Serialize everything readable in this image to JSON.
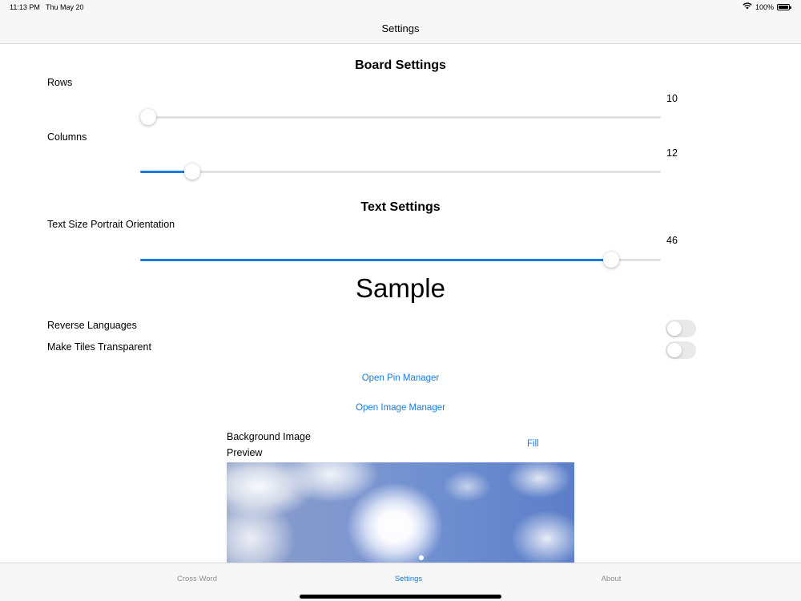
{
  "status_bar": {
    "time": "11:13 PM",
    "date": "Thu May 20",
    "battery": "100%",
    "icons": [
      "wifi-icon",
      "battery-icon"
    ]
  },
  "nav": {
    "title": "Settings"
  },
  "board_settings": {
    "title": "Board Settings",
    "rows": {
      "label": "Rows",
      "value": "10",
      "fill_fraction": 0.01
    },
    "columns": {
      "label": "Columns",
      "value": "12",
      "fill_fraction": 0.1
    }
  },
  "text_settings": {
    "title": "Text Settings",
    "text_size": {
      "label": "Text Size Portrait Orientation",
      "value": "46",
      "fill_fraction": 0.904
    },
    "sample": "Sample"
  },
  "toggles": {
    "reverse_languages": {
      "label": "Reverse Languages",
      "on": false
    },
    "make_tiles_transparent": {
      "label": "Make Tiles Transparent",
      "on": false
    }
  },
  "links": {
    "pin_manager": "Open Pin Manager",
    "image_manager": "Open Image Manager"
  },
  "background_image": {
    "label": "Background Image",
    "preview_label": "Preview",
    "mode": "Fill"
  },
  "tabs": [
    {
      "label": "Cross Word",
      "active": false
    },
    {
      "label": "Settings",
      "active": true
    },
    {
      "label": "About",
      "active": false
    }
  ],
  "colors": {
    "accent": "#1a7ce0",
    "track": "#e2e2e4",
    "bar_background": "#f7f7f7",
    "inactive_tab": "#8e8e93"
  }
}
